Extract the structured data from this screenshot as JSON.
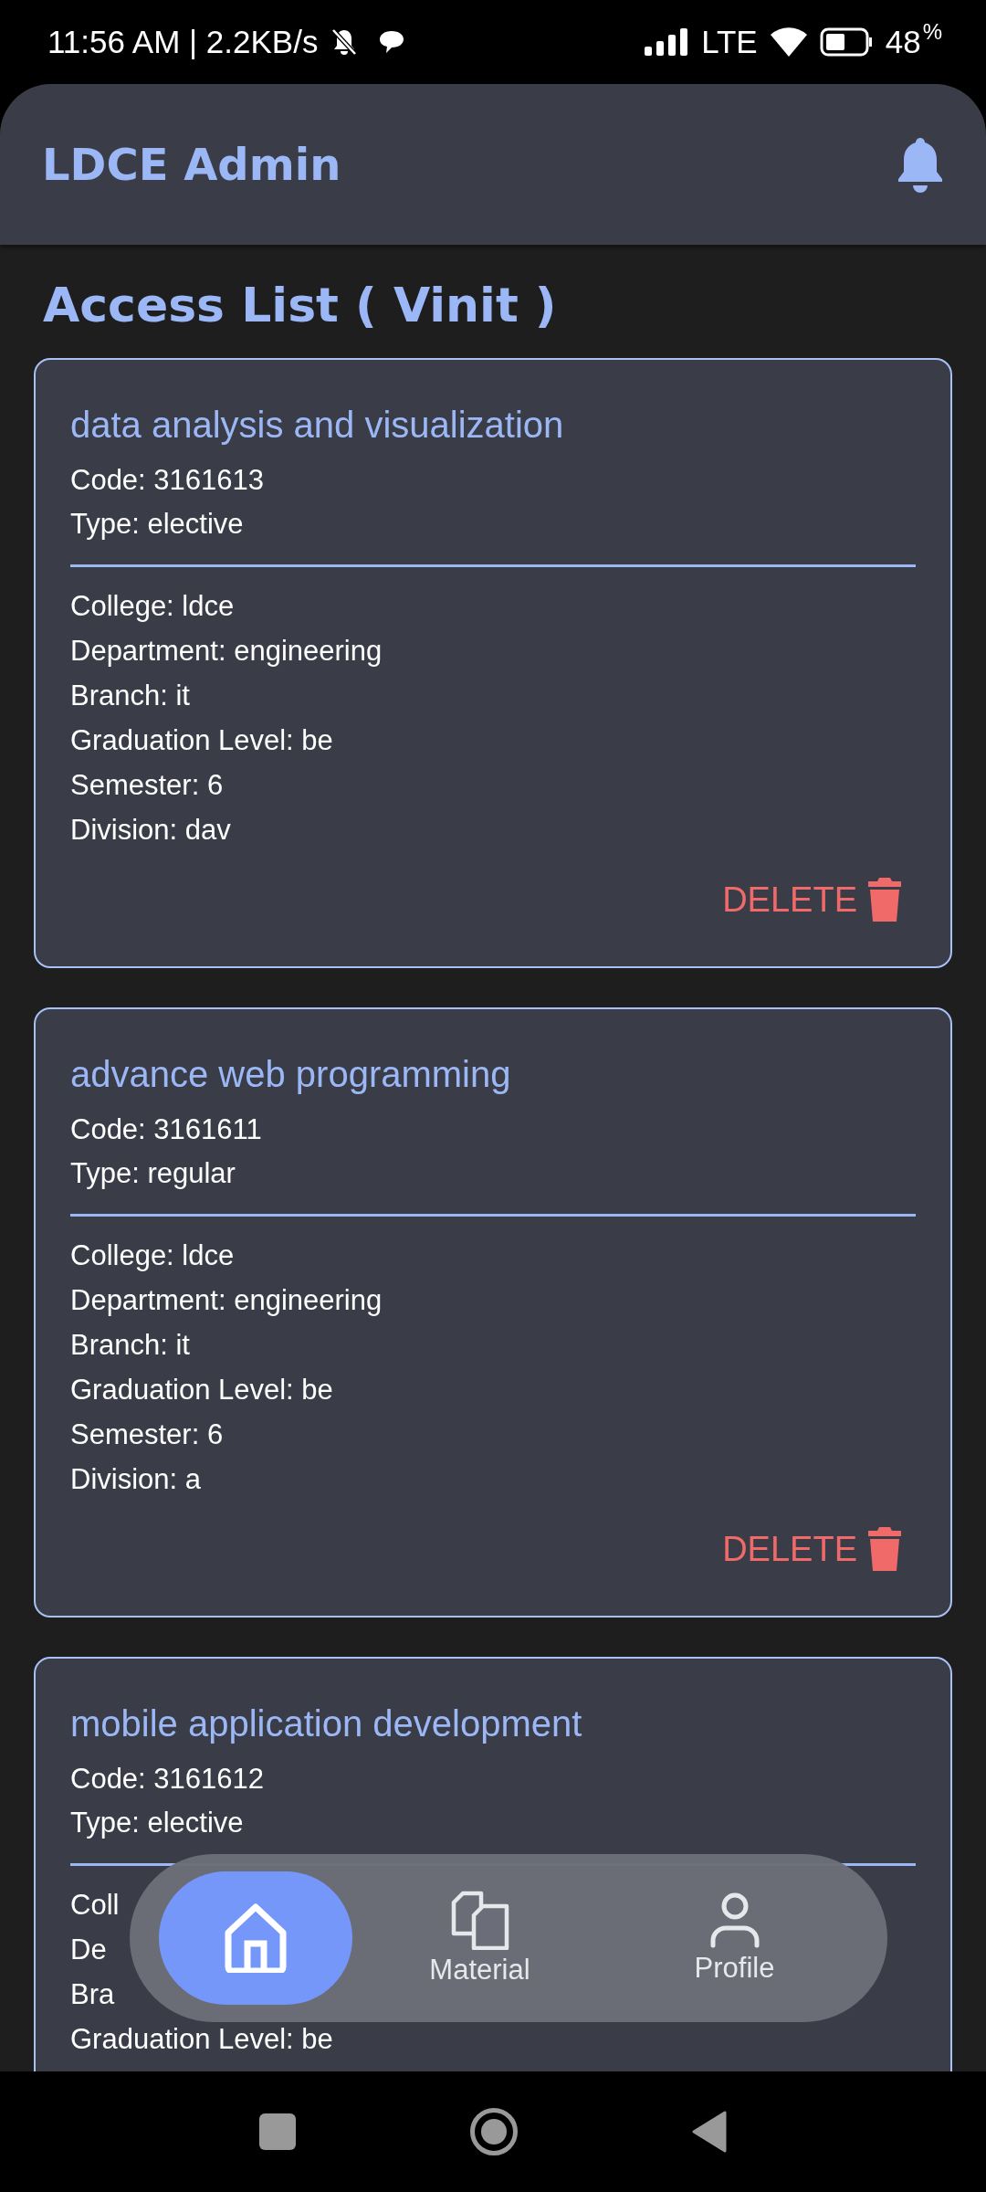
{
  "status_bar": {
    "time": "11:56 AM | 2.2KB/s",
    "network": "LTE",
    "battery": "48",
    "battery_unit": "%"
  },
  "app_bar": {
    "title": "LDCE Admin"
  },
  "page_title": "Access List ( Vinit )",
  "cards": [
    {
      "title": "data analysis and visualization",
      "lines": [
        "Code: 3161613",
        "Type: elective"
      ],
      "details": [
        "College: ldce",
        "Department: engineering",
        "Branch: it",
        "Graduation Level: be",
        "Semester: 6",
        "Division: dav"
      ],
      "action": "DELETE"
    },
    {
      "title": "advance web programming",
      "lines": [
        "Code: 3161611",
        "Type: regular"
      ],
      "details": [
        "College: ldce",
        "Department: engineering",
        "Branch: it",
        "Graduation Level: be",
        "Semester: 6",
        "Division: a"
      ],
      "action": "DELETE"
    },
    {
      "title": "mobile application development",
      "lines": [
        "Code: 3161612",
        "Type: elective"
      ],
      "details": [
        "Coll",
        "De",
        "Bra",
        "Graduation Level: be"
      ]
    }
  ],
  "bottom_nav": [
    {
      "kind": "home",
      "selected": true
    },
    {
      "kind": "material",
      "label": "Material",
      "selected": false
    },
    {
      "kind": "profile",
      "label": "Profile",
      "selected": false
    }
  ]
}
